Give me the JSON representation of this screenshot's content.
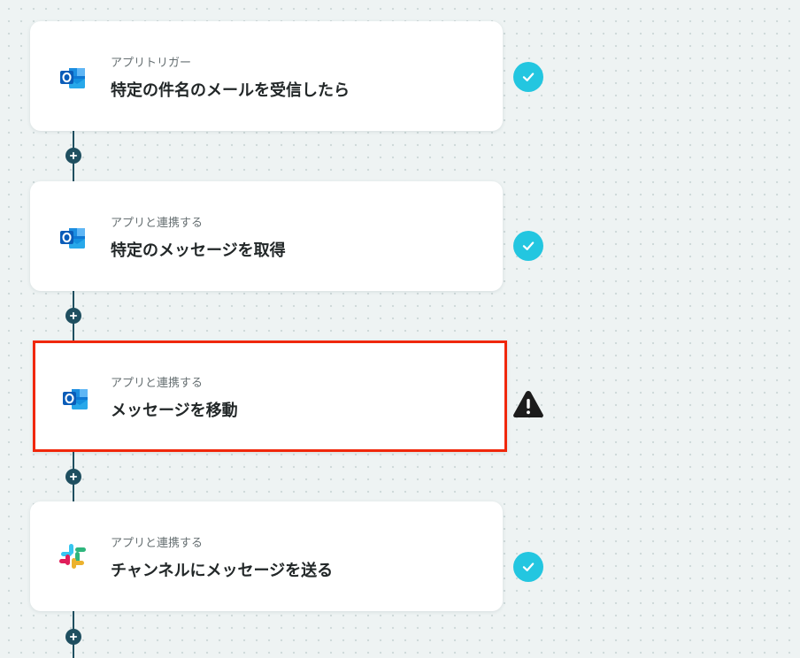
{
  "flow": {
    "steps": [
      {
        "kind": "アプリトリガー",
        "title": "特定の件名のメールを受信したら",
        "app_icon": "outlook-icon",
        "status": "success",
        "selected": false
      },
      {
        "kind": "アプリと連携する",
        "title": "特定のメッセージを取得",
        "app_icon": "outlook-icon",
        "status": "success",
        "selected": false
      },
      {
        "kind": "アプリと連携する",
        "title": "メッセージを移動",
        "app_icon": "outlook-icon",
        "status": "warning",
        "selected": true
      },
      {
        "kind": "アプリと連携する",
        "title": "チャンネルにメッセージを送る",
        "app_icon": "slack-icon",
        "status": "success",
        "selected": false
      }
    ],
    "add_step_icon": "plus-icon"
  },
  "colors": {
    "canvas_background": "#eef3f3",
    "connector": "#1f4f60",
    "success": "#23c6e0",
    "warning": "#1c1c1c",
    "selected_border": "#f0270b",
    "outlook_blue": "#0a64c4",
    "slack_red": "#e01e5a",
    "slack_blue": "#36c5f0",
    "slack_green": "#2eb67d",
    "slack_yellow": "#ecb22e"
  }
}
